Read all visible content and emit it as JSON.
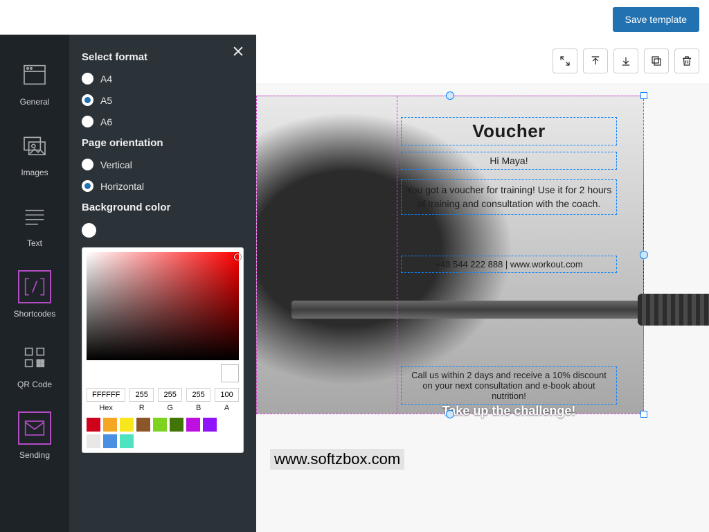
{
  "topbar": {
    "save": "Save template"
  },
  "rail": {
    "general": "General",
    "images": "Images",
    "text": "Text",
    "shortcodes": "Shortcodes",
    "qrcode": "QR Code",
    "sending": "Sending"
  },
  "panel": {
    "format_heading": "Select format",
    "formats": {
      "a4": "A4",
      "a5": "A5",
      "a6": "A6",
      "selected": "a5"
    },
    "orientation_heading": "Page orientation",
    "orientations": {
      "vertical": "Vertical",
      "horizontal": "Horizontal",
      "selected": "horizontal"
    },
    "bg_heading": "Background color",
    "bg_value": "#FFFFFF"
  },
  "picker": {
    "hex": "FFFFFF",
    "r": "255",
    "g": "255",
    "b": "255",
    "a": "100",
    "labels": {
      "hex": "Hex",
      "r": "R",
      "g": "G",
      "b": "B",
      "a": "A"
    },
    "swatches": [
      "#d0021b",
      "#f5a623",
      "#f8e71c",
      "#8b572a",
      "#7ed321",
      "#417505",
      "#bd10e0",
      "#9013fe",
      "#ffffff",
      "#e8e8e8",
      "#4a90e2",
      "#50e3c2"
    ]
  },
  "voucher": {
    "title": "Voucher",
    "greeting": "Hi Maya!",
    "body": "You got a voucher for training! Use it for 2 hours of training and consultation with the coach.",
    "contact": "+48 544 222  888 | www.workout.com",
    "offer": "Call us within 2 days and receive a 10% discount on your next consultation and e-book about nutrition!",
    "cta": "Take up the challenge!"
  },
  "watermark": "www.softzbox.com"
}
